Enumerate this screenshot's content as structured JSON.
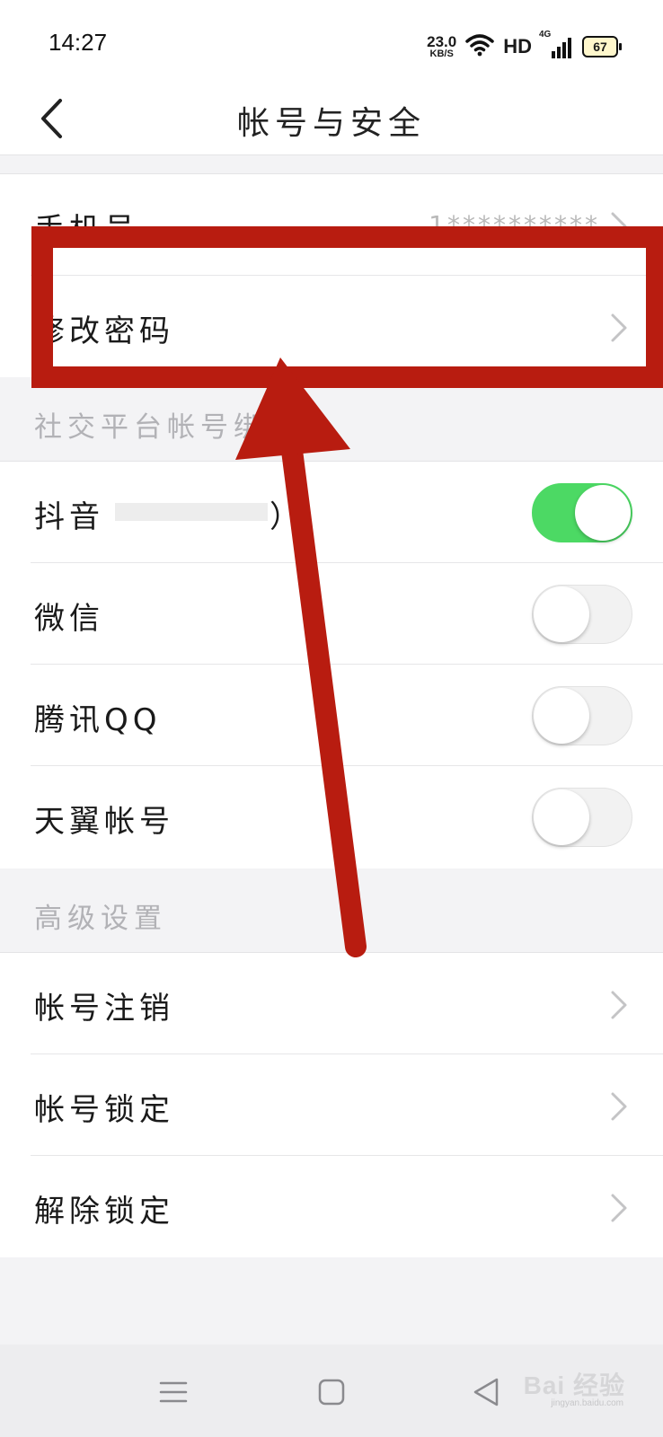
{
  "status_bar": {
    "time": "14:27",
    "net_speed_value": "23.0",
    "net_speed_unit": "KB/S",
    "hd_label": "HD",
    "signal_label": "4G",
    "battery": "67"
  },
  "header": {
    "title": "帐号与安全"
  },
  "account_section": {
    "rows": [
      {
        "label": "手机号",
        "value": "1**********"
      },
      {
        "label": "修改密码"
      }
    ]
  },
  "social_section": {
    "header": "社交平台帐号绑定",
    "rows": [
      {
        "label": "抖音",
        "suffix": "）",
        "enabled": true
      },
      {
        "label": "微信",
        "enabled": false
      },
      {
        "label": "腾讯QQ",
        "enabled": false
      },
      {
        "label": "天翼帐号",
        "enabled": false
      }
    ]
  },
  "advanced_section": {
    "header": "高级设置",
    "rows": [
      {
        "label": "帐号注销"
      },
      {
        "label": "帐号锁定"
      },
      {
        "label": "解除锁定"
      }
    ]
  },
  "watermark": {
    "text": "Bai 经验",
    "sub": "jingyan.baidu.com"
  },
  "colors": {
    "annotation_red": "#b81c10",
    "toggle_on": "#4cd964",
    "secondary_text": "#b2b2b6"
  }
}
